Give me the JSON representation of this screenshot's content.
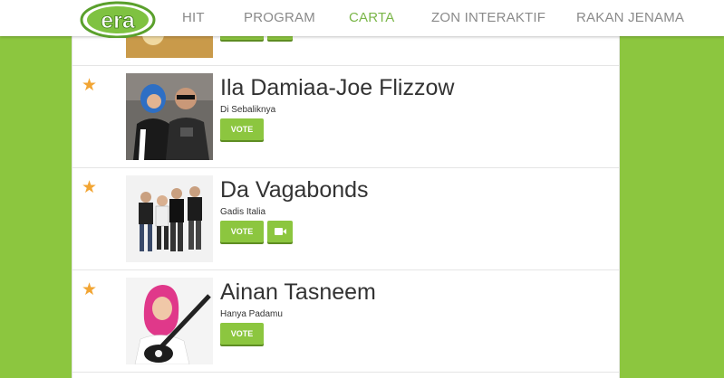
{
  "logo": {
    "text": "era"
  },
  "nav": {
    "items": [
      {
        "label": "HIT"
      },
      {
        "label": "PROGRAM"
      },
      {
        "label": "CARTA"
      },
      {
        "label": "ZON INTERAKTIF"
      },
      {
        "label": "RAKAN JENAMA"
      }
    ],
    "active": "CARTA"
  },
  "chart": {
    "entries": [
      {
        "artist": "",
        "song": "",
        "vote_label": "VOTE",
        "has_video": true,
        "starred": false
      },
      {
        "artist": "Ila Damiaa-Joe Flizzow",
        "song": "Di Sebaliknya",
        "vote_label": "VOTE",
        "has_video": false,
        "starred": true
      },
      {
        "artist": "Da Vagabonds",
        "song": "Gadis Italia",
        "vote_label": "VOTE",
        "has_video": true,
        "starred": true
      },
      {
        "artist": "Ainan Tasneem",
        "song": "Hanya Padamu",
        "vote_label": "VOTE",
        "has_video": false,
        "starred": true
      }
    ]
  },
  "colors": {
    "brand_green": "#8cc63f",
    "star": "#f2a533",
    "nav_active": "#7ab648",
    "nav_text": "#8a8a8a"
  }
}
